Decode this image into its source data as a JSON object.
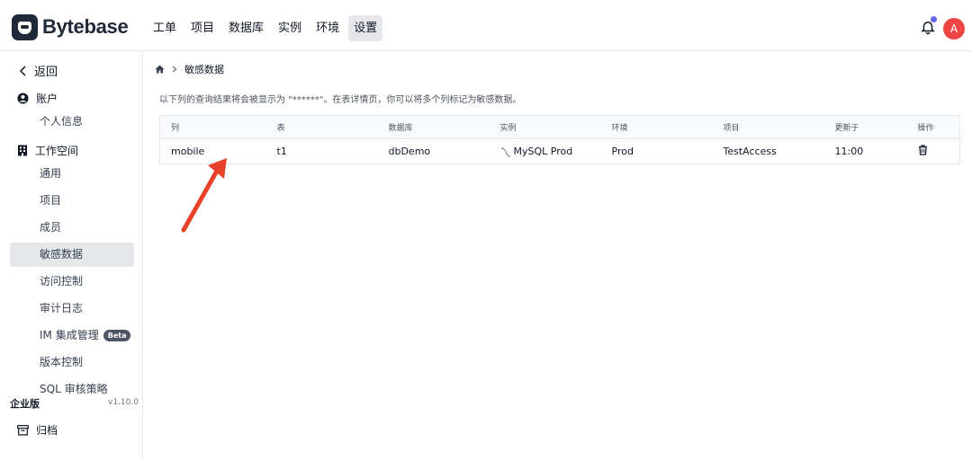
{
  "app": {
    "logo_text": "Bytebase"
  },
  "nav": {
    "items": [
      "工单",
      "项目",
      "数据库",
      "实例",
      "环境",
      "设置"
    ],
    "active_index": 5
  },
  "user": {
    "avatar_initial": "A"
  },
  "sidebar": {
    "back_label": "返回",
    "account_label": "账户",
    "profile_label": "个人信息",
    "workspace_label": "工作空间",
    "items": [
      "通用",
      "项目",
      "成员",
      "敏感数据",
      "访问控制",
      "审计日志",
      "IM 集成管理",
      "版本控制",
      "SQL 审核策略"
    ],
    "active_item": "敏感数据",
    "beta_badge": "Beta",
    "archive_label": "归档",
    "edition": "企业版",
    "version": "v1.10.0"
  },
  "breadcrumb": {
    "current": "敏感数据"
  },
  "description": "以下列的查询结果将会被显示为 \"******\"。在表详情页，你可以将多个列标记为敏感数据。",
  "table": {
    "headers": [
      "列",
      "表",
      "数据库",
      "实例",
      "环境",
      "项目",
      "更新于",
      "操作"
    ],
    "rows": [
      {
        "column": "mobile",
        "table": "t1",
        "database": "dbDemo",
        "instance": "MySQL Prod",
        "environment": "Prod",
        "project": "TestAccess",
        "updated": "11:00"
      }
    ]
  },
  "colors": {
    "accent": "#ef4444",
    "annotation_arrow": "#e8432a",
    "bell_dot": "#6366f1"
  }
}
